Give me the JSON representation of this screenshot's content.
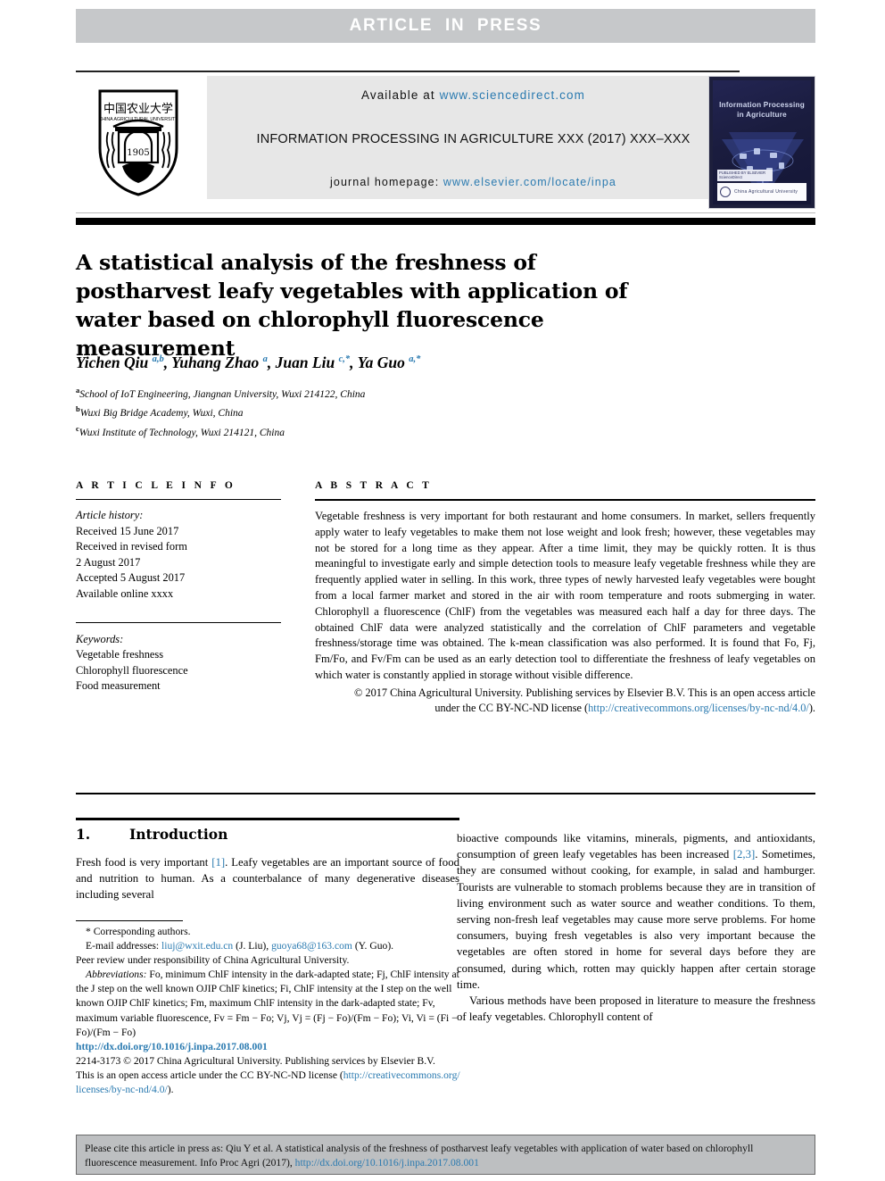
{
  "banner": {
    "label": "ARTICLE  IN  PRESS"
  },
  "masthead": {
    "available_prefix": "Available at ",
    "available_url": "www.sciencedirect.com",
    "journal_line": "INFORMATION PROCESSING IN AGRICULTURE XXX (2017) XXX–XXX",
    "homepage_prefix": "journal homepage: ",
    "homepage_url": "www.elsevier.com/locate/inpa",
    "logo_alt": "china-agricultural-university-logo",
    "cover": {
      "title": "Information Processing\nin Agriculture",
      "band_text": "PUBLISHED BY ELSEVIER\nScienceDirect",
      "footer_text": "China Agricultural University"
    }
  },
  "article": {
    "title": "A statistical analysis of the freshness of postharvest leafy vegetables with application of water based on chlorophyll fluorescence measurement",
    "authors_html": "Yichen Qiu <sup>a,b</sup>, Yuhang Zhao <sup>a</sup>, Juan Liu <sup>c,*</sup>, Ya Guo <sup>a,*</sup>",
    "affiliations": [
      {
        "marker": "a",
        "text": "School of IoT Engineering, Jiangnan University, Wuxi 214122, China"
      },
      {
        "marker": "b",
        "text": "Wuxi Big Bridge Academy, Wuxi, China"
      },
      {
        "marker": "c",
        "text": "Wuxi Institute of Technology, Wuxi 214121, China"
      }
    ]
  },
  "info": {
    "heading": "A R T I C L E   I N F O",
    "history_label": "Article history:",
    "history": [
      "Received 15 June 2017",
      "Received in revised form",
      "2 August 2017",
      "Accepted 5 August 2017",
      "Available online xxxx"
    ],
    "keywords_label": "Keywords:",
    "keywords": [
      "Vegetable freshness",
      "Chlorophyll fluorescence",
      "Food measurement"
    ]
  },
  "abstract": {
    "heading": "A B S T R A C T",
    "body": "Vegetable freshness is very important for both restaurant and home consumers. In market, sellers frequently apply water to leafy vegetables to make them not lose weight and look fresh; however, these vegetables may not be stored for a long time as they appear. After a time limit, they may be quickly rotten. It is thus meaningful to investigate early and simple detection tools to measure leafy vegetable freshness while they are frequently applied water in selling. In this work, three types of newly harvested leafy vegetables were bought from a local farmer market and stored in the air with room temperature and roots submerging in water. Chlorophyll a fluorescence (ChlF) from the vegetables was measured each half a day for three days. The obtained ChlF data were analyzed statistically and the correlation of ChlF parameters and vegetable freshness/storage time was obtained. The k-mean classification was also performed. It is found that Fo, Fj, Fm/Fo, and Fv/Fm can be used as an early detection tool to differentiate the freshness of leafy vegetables on which water is constantly applied in storage without visible difference.",
    "copyright_lead": "© 2017 China Agricultural University. Publishing services by Elsevier B.V. This is an open access article under the CC BY-NC-ND license (",
    "copyright_link": "http://creativecommons.org/licenses/by-nc-nd/4.0/",
    "copyright_tail": ")."
  },
  "intro": {
    "number": "1.",
    "heading": "Introduction",
    "left_paragraph_pre": "Fresh food is very important ",
    "left_ref": "[1]",
    "left_paragraph_post": ". Leafy vegetables are an important source of food and nutrition to human. As a counterbalance of many degenerative diseases including several",
    "right_paragraph_1_pre": "bioactive compounds like vitamins, minerals, pigments, and antioxidants, consumption of green leafy vegetables has been increased ",
    "right_ref": "[2,3]",
    "right_paragraph_1_post": ". Sometimes, they are consumed without cooking, for example, in salad and hamburger. Tourists are vulnerable to stomach problems because they are in transition of living environment such as water source and weather conditions. To them, serving non-fresh leaf vegetables may cause more serve problems. For home consumers, buying fresh vegetables is also very important because the vegetables are often stored in home for several days before they are consumed, during which, rotten may quickly happen after certain storage time.",
    "right_paragraph_2": "Various methods have been proposed in literature to measure the freshness of leafy vegetables. Chlorophyll content of"
  },
  "footnote": {
    "corresponding": "* Corresponding authors.",
    "email_label": "E-mail addresses: ",
    "email_1": "liuj@wxit.edu.cn",
    "email_1_who": " (J. Liu), ",
    "email_2": "guoya68@163.com",
    "email_2_who": " (Y. Guo).",
    "peer_review": "Peer review under responsibility of China Agricultural University.",
    "abbrev_label": "Abbreviations:",
    "abbrev_text": " Fo, minimum ChlF intensity in the dark-adapted state; Fj, ChlF intensity at the J step on the well known OJIP ChlF kinetics; Fi, ChlF intensity at the I step on the well known OJIP ChlF kinetics; Fm, maximum ChlF intensity in the dark-adapted state; Fv, maximum variable fluorescence, Fv = Fm − Fo; Vj, Vj = (Fj − Fo)/(Fm − Fo); Vi, Vi = (Fi − Fo)/(Fm − Fo)",
    "doi": "http://dx.doi.org/10.1016/j.inpa.2017.08.001",
    "issn_line": "2214-3173 © 2017 China Agricultural University. Publishing services by Elsevier B.V.",
    "license_pre": "This is an open access article under the CC BY-NC-ND license (",
    "license_link": "http://creativecommons.org/licenses/by-nc-nd/4.0/",
    "license_post": ")."
  },
  "cite_box": {
    "text_pre": "Please cite this article in press as: Qiu Y et al. A statistical analysis of the freshness of postharvest leafy vegetables with application of water based on chlorophyll fluorescence measurement. Info Proc Agri (2017), ",
    "link": "http://dx.doi.org/10.1016/j.inpa.2017.08.001"
  },
  "colors": {
    "link": "#2a7ab0",
    "banner_bg": "#c6c8ca",
    "masthead_bg": "#e7e7e7",
    "cite_bg": "#bdbfc1"
  }
}
